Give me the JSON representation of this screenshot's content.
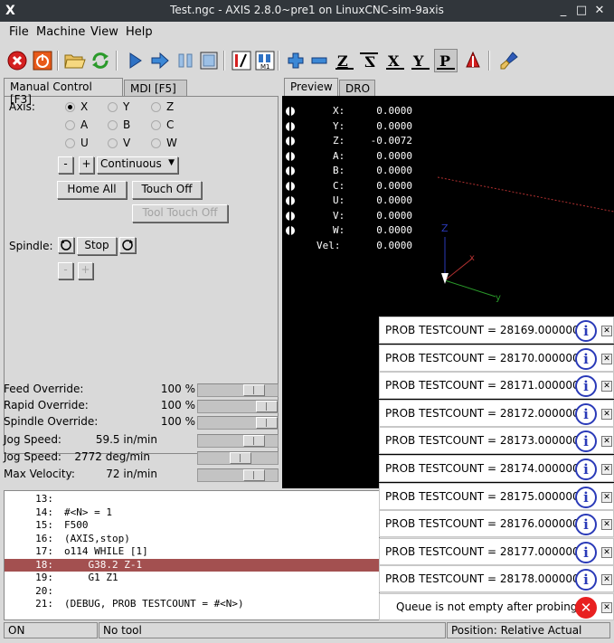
{
  "window": {
    "title": "Test.ngc - AXIS 2.8.0~pre1 on LinuxCNC-sim-9axis",
    "minimize": "_",
    "maximize": "□",
    "close": "✕"
  },
  "menu": {
    "file": "File",
    "machine": "Machine",
    "view": "View",
    "help": "Help"
  },
  "toolbar": {
    "items": [
      "estop",
      "power",
      "open",
      "reload",
      "run",
      "step",
      "pause",
      "stop",
      "blockdelete",
      "optionalstop",
      "zoomin",
      "zoomout",
      "view-z",
      "view-z2",
      "view-x",
      "view-y",
      "view-p",
      "rotate",
      "clear"
    ],
    "view_z": "Z",
    "view_x": "X",
    "view_y": "Y",
    "view_p": "P"
  },
  "left": {
    "tab_manual": "Manual Control [F3]",
    "tab_mdi": "MDI [F5]",
    "axis_label": "Axis:",
    "axes": [
      "X",
      "Y",
      "Z",
      "A",
      "B",
      "C",
      "U",
      "V",
      "W"
    ],
    "selected_axis": "X",
    "jog_minus": "-",
    "jog_plus": "+",
    "jog_mode": "Continuous",
    "home_all": "Home All",
    "touch_off": "Touch Off",
    "tool_touch_off": "Tool Touch Off",
    "spindle_label": "Spindle:",
    "spindle_stop": "Stop",
    "spindle_minus": "-",
    "spindle_plus": "+"
  },
  "overrides": [
    {
      "label": "Feed Override:",
      "value": "100 %",
      "level": 0.78
    },
    {
      "label": "Rapid Override:",
      "value": "100 %",
      "level": 1.0
    },
    {
      "label": "Spindle Override:",
      "value": "100 %",
      "level": 1.0
    },
    {
      "label": "Jog Speed:",
      "value": "59.5 in/min",
      "level": 0.78
    },
    {
      "label": "Jog Speed:",
      "value": "2772 deg/min",
      "level": 0.55
    },
    {
      "label": "Max Velocity:",
      "value": "72 in/min",
      "level": 0.78
    }
  ],
  "right": {
    "tab_preview": "Preview",
    "tab_dro": "DRO"
  },
  "dro": [
    {
      "axis": "X:",
      "value": "0.0000"
    },
    {
      "axis": "Y:",
      "value": "0.0000"
    },
    {
      "axis": "Z:",
      "value": "-0.0072"
    },
    {
      "axis": "A:",
      "value": "0.0000"
    },
    {
      "axis": "B:",
      "value": "0.0000"
    },
    {
      "axis": "C:",
      "value": "0.0000"
    },
    {
      "axis": "U:",
      "value": "0.0000"
    },
    {
      "axis": "V:",
      "value": "0.0000"
    },
    {
      "axis": "W:",
      "value": "0.0000"
    },
    {
      "axis": "Vel:",
      "value": "0.0000"
    }
  ],
  "preview_axis": {
    "z": "Z",
    "x": "x",
    "y": "y"
  },
  "gcode": [
    {
      "n": "13:",
      "code": ""
    },
    {
      "n": "14:",
      "code": "#<N> = 1"
    },
    {
      "n": "15:",
      "code": "F500"
    },
    {
      "n": "16:",
      "code": "(AXIS,stop)"
    },
    {
      "n": "17:",
      "code": "o114 WHILE [1]"
    },
    {
      "n": "18:",
      "code": "    G38.2 Z-1"
    },
    {
      "n": "19:",
      "code": "    G1 Z1"
    },
    {
      "n": "20:",
      "code": ""
    },
    {
      "n": "21:",
      "code": "(DEBUG, PROB TESTCOUNT = #<N>)"
    }
  ],
  "gcode_highlight_index": 5,
  "notifications": [
    {
      "text": "PROB TESTCOUNT = 28169.000000",
      "kind": "info"
    },
    {
      "text": "PROB TESTCOUNT = 28170.000000",
      "kind": "info"
    },
    {
      "text": "PROB TESTCOUNT = 28171.000000",
      "kind": "info"
    },
    {
      "text": "PROB TESTCOUNT = 28172.000000",
      "kind": "info"
    },
    {
      "text": "PROB TESTCOUNT = 28173.000000",
      "kind": "info"
    },
    {
      "text": "PROB TESTCOUNT = 28174.000000",
      "kind": "info"
    },
    {
      "text": "PROB TESTCOUNT = 28175.000000",
      "kind": "info"
    },
    {
      "text": "PROB TESTCOUNT = 28176.000000",
      "kind": "info"
    },
    {
      "text": "PROB TESTCOUNT = 28177.000000",
      "kind": "info"
    },
    {
      "text": "PROB TESTCOUNT = 28178.000000",
      "kind": "info"
    },
    {
      "text": "Queue is not empty after probing",
      "kind": "error"
    }
  ],
  "notif_info_glyph": "i",
  "notif_error_glyph": "✕",
  "notif_close_glyph": "✕",
  "status": {
    "state": "ON",
    "tool": "No tool",
    "position": "Position: Relative Actual"
  },
  "colors": {
    "highlight_line": "#a35050",
    "preview_bg": "#000000",
    "info_icon": "#2a3ab8",
    "error_icon": "#e82020",
    "estop": "#d42020",
    "power": "#e85a1a",
    "run": "#2f72c4"
  }
}
